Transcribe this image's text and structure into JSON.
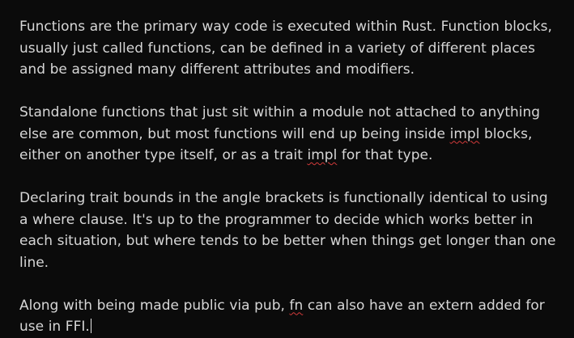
{
  "document": {
    "p1": "Functions are the primary way code is executed within Rust. Function blocks, usually just called functions, can be defined in a variety of different places and be assigned many different attributes and modifiers.",
    "p2": {
      "a": "Standalone functions that just sit within a module not attached to anything else are common, but most functions will end up being inside ",
      "w1": "impl",
      "b": " blocks, either on another type itself, or as a trait ",
      "w2": "impl",
      "c": " for that type."
    },
    "p3": "Declaring trait bounds in the angle brackets is functionally identical to using a where clause. It's up to the programmer to decide which works better in each situation, but where tends to be better when things get longer than one line.",
    "p4": {
      "a": "Along with being made public via pub, ",
      "w1": "fn",
      "b": " can also have an extern added for use in FFI."
    }
  },
  "colors": {
    "background": "#0b0b0b",
    "text": "#d6d6d6",
    "spellcheck_underline": "#d33a3a"
  }
}
